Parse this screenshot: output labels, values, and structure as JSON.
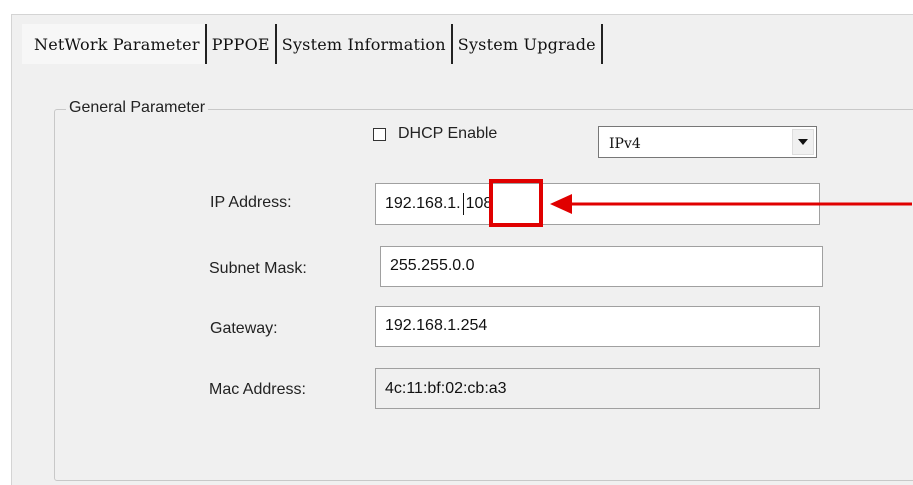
{
  "tabs": [
    {
      "label": "NetWork Parameter"
    },
    {
      "label": "PPPOE"
    },
    {
      "label": "System Information"
    },
    {
      "label": "System Upgrade"
    }
  ],
  "group": {
    "title": "General Parameter"
  },
  "dhcp": {
    "label": "DHCP Enable",
    "checked": false
  },
  "ip_version": {
    "selected": "IPv4"
  },
  "fields": {
    "ip": {
      "label": "IP Address:",
      "value_prefix": "192.168.1.",
      "value_last_octet": "108"
    },
    "subnet": {
      "label": "Subnet Mask:",
      "value": "255.255.0.0"
    },
    "gateway": {
      "label": "Gateway:",
      "value": "192.168.1.254"
    },
    "mac": {
      "label": "Mac Address:",
      "value": "4c:11:bf:02:cb:a3"
    }
  },
  "colors": {
    "annotation": "#e00000"
  }
}
